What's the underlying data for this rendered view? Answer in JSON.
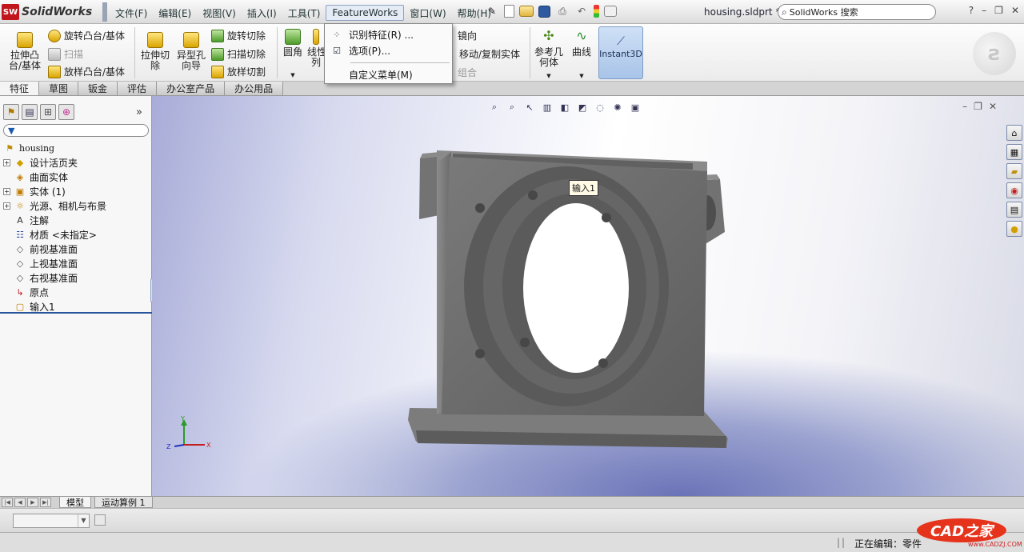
{
  "app": {
    "logo": "SolidWorks",
    "filename": "housing.sldprt *",
    "search_placeholder": "SolidWorks 搜索"
  },
  "menu": {
    "items": [
      "文件(F)",
      "编辑(E)",
      "视图(V)",
      "插入(I)",
      "工具(T)",
      "FeatureWorks",
      "窗口(W)",
      "帮助(H)"
    ],
    "active_index": 5
  },
  "commands": {
    "extrude_boss": "拉伸凸\n台/基体",
    "revolve_boss": "旋转凸台/基体",
    "sweep": "扫描",
    "loft_boss": "放样凸台/基体",
    "extrude_cut": "拉伸切\n除",
    "hole_wizard": "异型孔\n向导",
    "revolve_cut": "旋转切除",
    "sweep_cut": "扫描切除",
    "loft_cut": "放样切割",
    "fillet": "圆角",
    "linear_pattern": "线性\n列",
    "mirror": "镜向",
    "move_copy": "移动/复制实体",
    "group": "组合",
    "ref_geometry": "参考几\n何体",
    "curves": "曲线",
    "instant3d": "Instant3D"
  },
  "dropdown": {
    "items": [
      "识别特征(R) ...",
      "选项(P)...",
      "自定义菜单(M)"
    ]
  },
  "tabs": {
    "items": [
      "特征",
      "草图",
      "钣金",
      "评估",
      "办公室产品",
      "办公用品"
    ],
    "active_index": 0
  },
  "tree": {
    "root": "housing",
    "nodes": [
      {
        "label": "设计活页夹",
        "expand": true,
        "icon": "folder"
      },
      {
        "label": "曲面实体",
        "expand": false,
        "icon": "surface"
      },
      {
        "label": "实体 (1)",
        "expand": true,
        "icon": "solid"
      },
      {
        "label": "光源、相机与布景",
        "expand": true,
        "icon": "lights"
      },
      {
        "label": "注解",
        "expand": false,
        "icon": "annotation"
      },
      {
        "label": "材质 <未指定>",
        "expand": false,
        "icon": "material"
      },
      {
        "label": "前视基准面",
        "expand": false,
        "icon": "plane"
      },
      {
        "label": "上视基准面",
        "expand": false,
        "icon": "plane"
      },
      {
        "label": "右视基准面",
        "expand": false,
        "icon": "plane"
      },
      {
        "label": "原点",
        "expand": false,
        "icon": "origin"
      },
      {
        "label": "输入1",
        "expand": false,
        "icon": "feature"
      }
    ]
  },
  "viewport": {
    "tooltip": "输入1",
    "triad": {
      "x": "X",
      "y": "Y",
      "z": "Z"
    }
  },
  "bottom_tabs": {
    "items": [
      "模型",
      "运动算例 1"
    ],
    "active_index": 0
  },
  "status": {
    "text": "正在编辑：零件"
  },
  "watermark": {
    "text": "CAD之家",
    "small": "www.CADZJ.COM"
  },
  "colors": {
    "logo_red": "#c0161c",
    "part_gray": "#6e6e6e",
    "accent_blue": "#28559a"
  }
}
